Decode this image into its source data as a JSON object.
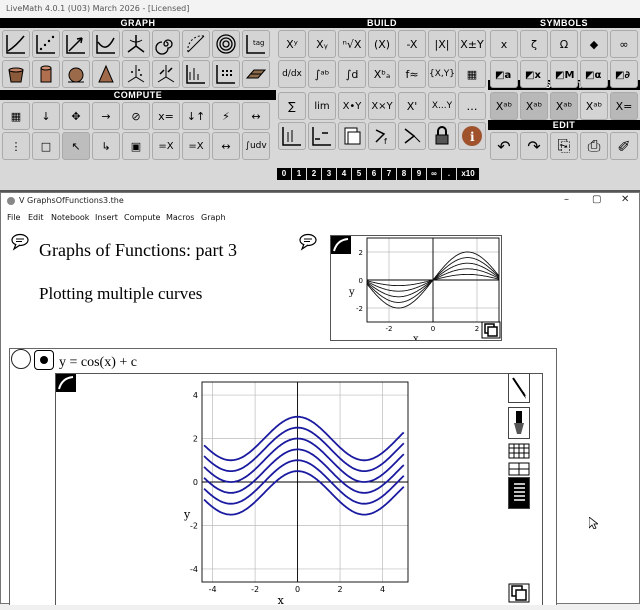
{
  "app": {
    "title": "LiveMath 4.0.1 (U03) March 2026 - [Licensed]"
  },
  "sections": {
    "graph": "GRAPH",
    "build": "BUILD",
    "symbols": "SYMBOLS",
    "compute": "COMPUTE",
    "select": "SELECT",
    "edit": "EDIT"
  },
  "palette": {
    "build_row1": [
      "Xʸ",
      "Xᵧ",
      "ⁿ√X",
      "(X)",
      "-X",
      "|X|",
      "X±Y"
    ],
    "build_row2": [
      "d/dx",
      "∫ᵃᵇ",
      "∫d",
      "Xᵇₐ",
      "f≈",
      "{X,Y}",
      "▦"
    ],
    "build_row3": [
      "∑",
      "lim",
      "X•Y",
      "X×Y",
      "X'",
      "X...Y",
      "…"
    ],
    "symbols_row1": [
      "x",
      "ζ",
      "Ω",
      "◆",
      "∞"
    ],
    "compute_row1": [
      "▦",
      "↓",
      "✥",
      "→",
      "⊘",
      "x=",
      "↓↑",
      "⚡",
      "↔"
    ],
    "compute_row2": [
      "⋮",
      "□",
      "↖",
      "↳",
      "▣",
      "=X",
      "=X",
      "↔",
      "∫udv"
    ],
    "select_row": [
      "Xᵃᵇ",
      "Xᵃᵇ",
      "Xᵃᵇ",
      "Xᵃᵇ",
      "X="
    ],
    "edit_row": [
      "↶",
      "↷",
      "⎘",
      "⎙",
      "✐"
    ],
    "numkeys": [
      "0",
      "1",
      "2",
      "3",
      "4",
      "5",
      "6",
      "7",
      "8",
      "9",
      "∞",
      ".",
      "x10"
    ]
  },
  "window": {
    "title": "V GraphsOfFunctions3.the",
    "minimize": "–",
    "maximize": "▢",
    "close": "✕",
    "menu": [
      "File",
      "Edit",
      "Notebook",
      "Insert",
      "Compute",
      "Macros",
      "Graph"
    ]
  },
  "document": {
    "heading1": "Graphs of Functions: part 3",
    "heading2": "Plotting multiple curves",
    "equation": "y  =  cos(x) + c"
  },
  "colors": {
    "curve": "#1a1aa0",
    "mini_curve": "#111111",
    "grid": "#bbbbbb"
  },
  "chart_data": [
    {
      "type": "line",
      "title": "",
      "xlabel": "x",
      "ylabel": "y",
      "xlim": [
        -3,
        3
      ],
      "ylim": [
        -3,
        3
      ],
      "x_ticks": [
        "-2",
        "0",
        "2"
      ],
      "y_ticks": [
        "2",
        "0",
        "-2"
      ],
      "function": "c*sin(x)",
      "c_values": [
        0.4,
        0.8,
        1.2,
        1.6,
        2.0
      ],
      "grid": true
    },
    {
      "type": "line",
      "title": "",
      "xlabel": "x",
      "ylabel": "y",
      "xlim": [
        -4.5,
        5.2
      ],
      "ylim": [
        -4.6,
        4.6
      ],
      "x_ticks": [
        "-4",
        "-2",
        "0",
        "2",
        "4"
      ],
      "y_ticks": [
        "4",
        "2",
        "0",
        "-2",
        "-4"
      ],
      "function": "cos(x)+c",
      "c_values": [
        -0.5,
        0,
        0.5,
        1,
        1.5,
        2
      ],
      "x_range": [
        -4.4,
        5.0
      ],
      "grid": true
    }
  ]
}
